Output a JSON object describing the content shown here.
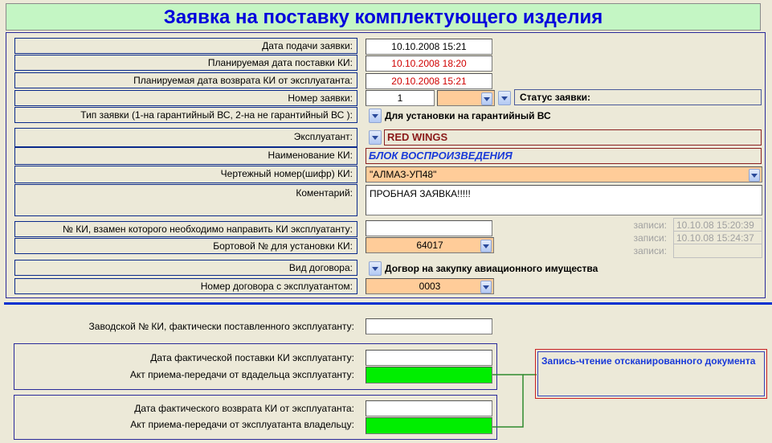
{
  "title": "Заявка на поставку комплектующего изделия",
  "labels": {
    "submit_date": "Дата подачи заявки:",
    "planned_delivery": "Планируемая дата поставки КИ:",
    "planned_return": "Планируемая дата возврата КИ от эксплуатанта:",
    "request_number": "Номер заявки:",
    "request_type": "Тип заявки (1-на гарантийный ВС, 2-на не гарантийный ВС ):",
    "operator": "Эксплуатант:",
    "ki_name": "Наименование КИ:",
    "drawing_number": "Чертежный номер(шифр) КИ:",
    "comment": "Коментарий:",
    "replace_ki_no": "№ КИ, взамен которого необходимо направить КИ эксплуатанту:",
    "board_no": "Бортовой № для установки КИ:",
    "contract_type": "Вид договора:",
    "contract_number": "Номер договора с эксплуатантом:",
    "factory_no": "Заводской № КИ, фактически поставленного эксплуатанту:",
    "actual_delivery_date": "Дата фактической поставки КИ эксплуатанту:",
    "act_owner_to_operator": "Акт приема-передачи от вдадельца эксплуатанту:",
    "actual_return_date": "Дата фактического возврата КИ от эксплуатанта:",
    "act_operator_to_owner": "Акт приема-передачи от эксплуатанта владельцу:"
  },
  "values": {
    "submit_date": "10.10.2008 15:21",
    "planned_delivery": "10.10.2008 18:20",
    "planned_return": "20.10.2008 15:21",
    "request_number": "1",
    "status_label": "Статус заявки:",
    "request_type_text": "Для установки на гарантийный ВС",
    "operator": "RED WINGS",
    "ki_name": "БЛОК ВОСПРОИЗВЕДЕНИЯ",
    "drawing_number": "\"АЛМАЗ-УП48\"",
    "comment": "ПРОБНАЯ ЗАЯВКА!!!!!",
    "replace_ki_no": "",
    "board_no": "64017",
    "contract_type_text": "Догвор на закупку авиационного имущества",
    "contract_number": "0003",
    "factory_no": "",
    "actual_delivery_date": "",
    "actual_return_date": ""
  },
  "records": {
    "label": "записи:",
    "created": "10.10.08 15:20:39",
    "modified": "10.10.08 15:24:37",
    "third": ""
  },
  "scan_button": "Запись-чтение отсканированного документа",
  "colors": {
    "title_bg": "#c4f6c4",
    "title_text": "#0000dd",
    "field_highlight": "#ffcc99",
    "act_green": "#00ee00",
    "date_red": "#d00000",
    "separator_blue": "#0030d0"
  }
}
